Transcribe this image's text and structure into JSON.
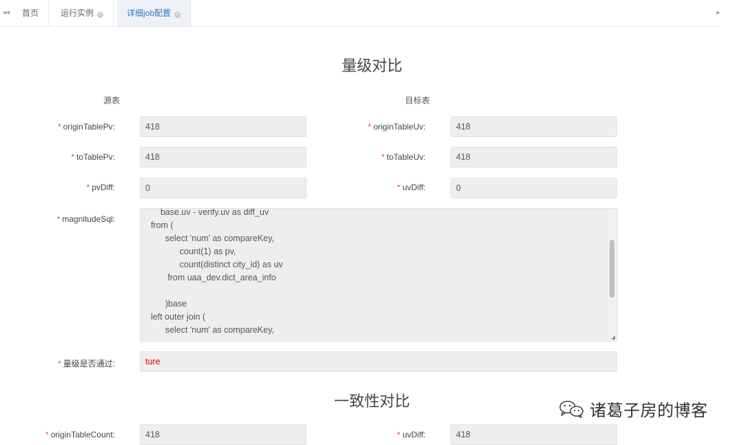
{
  "tabs": {
    "nav_left": "◂◂",
    "nav_right": "▸",
    "items": [
      {
        "label": "首页",
        "closable": false,
        "active": false
      },
      {
        "label": "运行实例",
        "closable": true,
        "active": false
      },
      {
        "label": "详细job配置",
        "closable": true,
        "active": true
      }
    ],
    "close_glyph": "×"
  },
  "magnitude": {
    "title": "量级对比",
    "source_header": "源表",
    "target_header": "目标表",
    "required_mark": "*",
    "fields": {
      "originTablePv": {
        "label": "originTablePv:",
        "value": "418"
      },
      "originTableUv": {
        "label": "originTableUv:",
        "value": "418"
      },
      "toTablePv": {
        "label": "toTablePv:",
        "value": "418"
      },
      "toTableUv": {
        "label": "toTableUv:",
        "value": "418"
      },
      "pvDiff": {
        "label": "pvDiff:",
        "value": "0"
      },
      "uvDiff": {
        "label": "uvDiff:",
        "value": "0"
      },
      "magnitudeSql": {
        "label": "magnitudeSql:",
        "value": "      base.uv - verify.uv as diff_uv\n  from (\n        select 'num' as compareKey,\n              count(1) as pv,\n              count(distinct city_id) as uv\n         from uaa_dev.dict_area_info\n\n        )base\n  left outer join (\n        select 'num' as compareKey,"
      },
      "passed": {
        "label": "量级是否通过:",
        "value": "ture"
      }
    }
  },
  "consistency": {
    "title": "一致性对比",
    "fields": {
      "originTableCount": {
        "label": "originTableCount:",
        "value": "418"
      },
      "uvDiff": {
        "label": "uvDiff:",
        "value": "418"
      }
    }
  },
  "watermark": {
    "icon": "wechat-icon",
    "text": "诸葛子房的博客"
  },
  "colors": {
    "required": "#e74c3c",
    "active_tab_text": "#337ab7",
    "field_bg": "#eeeeee",
    "passed_value": "#e60000"
  }
}
